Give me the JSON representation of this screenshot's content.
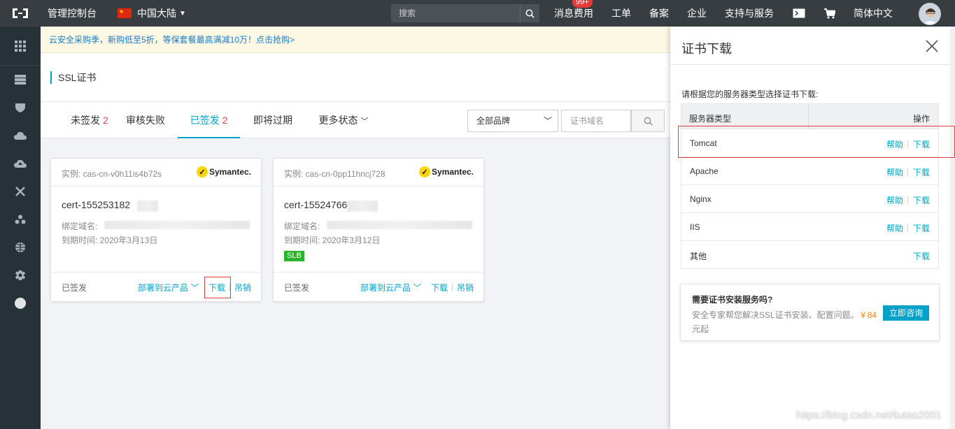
{
  "topbar": {
    "console_title": "管理控制台",
    "region": "中国大陆",
    "search_placeholder": "搜索",
    "nav": {
      "messages": "消息",
      "messages_badge": "99+",
      "billing": "费用",
      "tickets": "工单",
      "icp": "备案",
      "enterprise": "企业",
      "support": "支持与服务",
      "language": "简体中文"
    }
  },
  "sidebar": {
    "icons": [
      "grid-icon",
      "server-icon",
      "shield-icon",
      "cloud-icon",
      "cloud-upload-icon",
      "network-icon",
      "cluster-icon",
      "globe-icon",
      "gear-icon",
      "circle-icon"
    ]
  },
  "main": {
    "promo": "云安全采购季，新购低至5折，等保套餐最高满减10万！点击抢购>",
    "page_title": "SSL证书",
    "tabs": [
      {
        "label": "未签发",
        "count": "2"
      },
      {
        "label": "审核失败",
        "count": ""
      },
      {
        "label": "已签发",
        "count": "2"
      },
      {
        "label": "即将过期",
        "count": ""
      },
      {
        "label": "更多状态",
        "count": ""
      }
    ],
    "brand_select": "全部品牌",
    "domain_placeholder": "证书域名",
    "cards": [
      {
        "instance": "实例: cas-cn-v0h11is4b72s",
        "brand": "Symantec.",
        "cert_name": "cert-155253182",
        "domain_label": "绑定域名:",
        "expire": "到期时间: 2020年3月13日",
        "tag": "",
        "status": "已签发",
        "deploy": "部署到云产品",
        "download": "下载",
        "revoke": "吊销"
      },
      {
        "instance": "实例: cas-cn-0pp11hncj728",
        "brand": "Symantec.",
        "cert_name": "cert-15524766",
        "domain_label": "绑定域名:",
        "expire": "到期时间: 2020年3月12日",
        "tag": "SLB",
        "status": "已签发",
        "deploy": "部署到云产品",
        "download": "下载",
        "revoke": "吊销"
      }
    ]
  },
  "drawer": {
    "title": "证书下载",
    "hint": "请根据您的服务器类型选择证书下载:",
    "col_server": "服务器类型",
    "col_action": "操作",
    "rows": [
      {
        "name": "Tomcat",
        "help": "帮助",
        "download": "下载"
      },
      {
        "name": "Apache",
        "help": "帮助",
        "download": "下载"
      },
      {
        "name": "Nginx",
        "help": "帮助",
        "download": "下载"
      },
      {
        "name": "IIS",
        "help": "帮助",
        "download": "下载"
      },
      {
        "name": "其他",
        "help": "",
        "download": "下载"
      }
    ],
    "promo_question": "需要证书安装服务吗?",
    "promo_desc": "安全专家帮您解决SSL证书安装、配置问题。",
    "promo_price": "￥84",
    "promo_unit": "元起",
    "promo_cta": "立即咨询"
  },
  "watermark": "https://blog.csdn.net/liutao2001",
  "colors": {
    "accent": "#00a2ca",
    "topbar": "#373d41",
    "sidebar": "#263238",
    "highlight": "#e23b3b"
  }
}
